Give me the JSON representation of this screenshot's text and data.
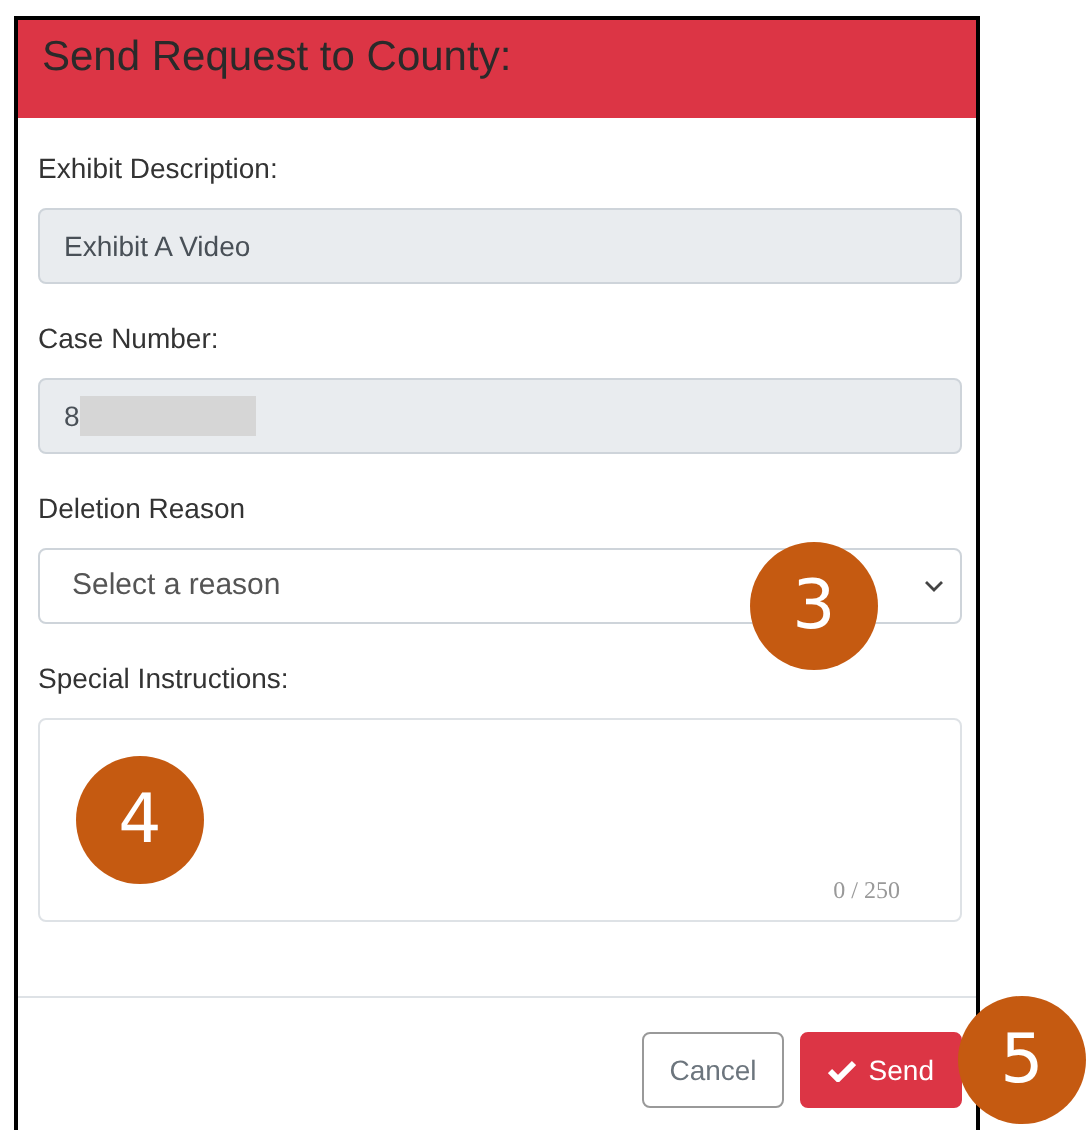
{
  "modal": {
    "title": "Send Request to County:"
  },
  "fields": [
    {
      "kind": "readonly",
      "label": "Exhibit Description:",
      "value": "Exhibit A Video"
    },
    {
      "kind": "redacted",
      "label": "Case Number:",
      "value": "8"
    },
    {
      "kind": "select",
      "label": "Deletion Reason",
      "placeholder": "Select a reason"
    },
    {
      "kind": "textarea",
      "label": "Special Instructions:",
      "counter": "0 / 250"
    }
  ],
  "buttons": [
    {
      "label": "Cancel",
      "kind": "secondary"
    },
    {
      "label": "Send",
      "kind": "danger"
    }
  ],
  "callouts": [
    {
      "label": "3"
    },
    {
      "label": "4"
    },
    {
      "label": "5"
    }
  ]
}
